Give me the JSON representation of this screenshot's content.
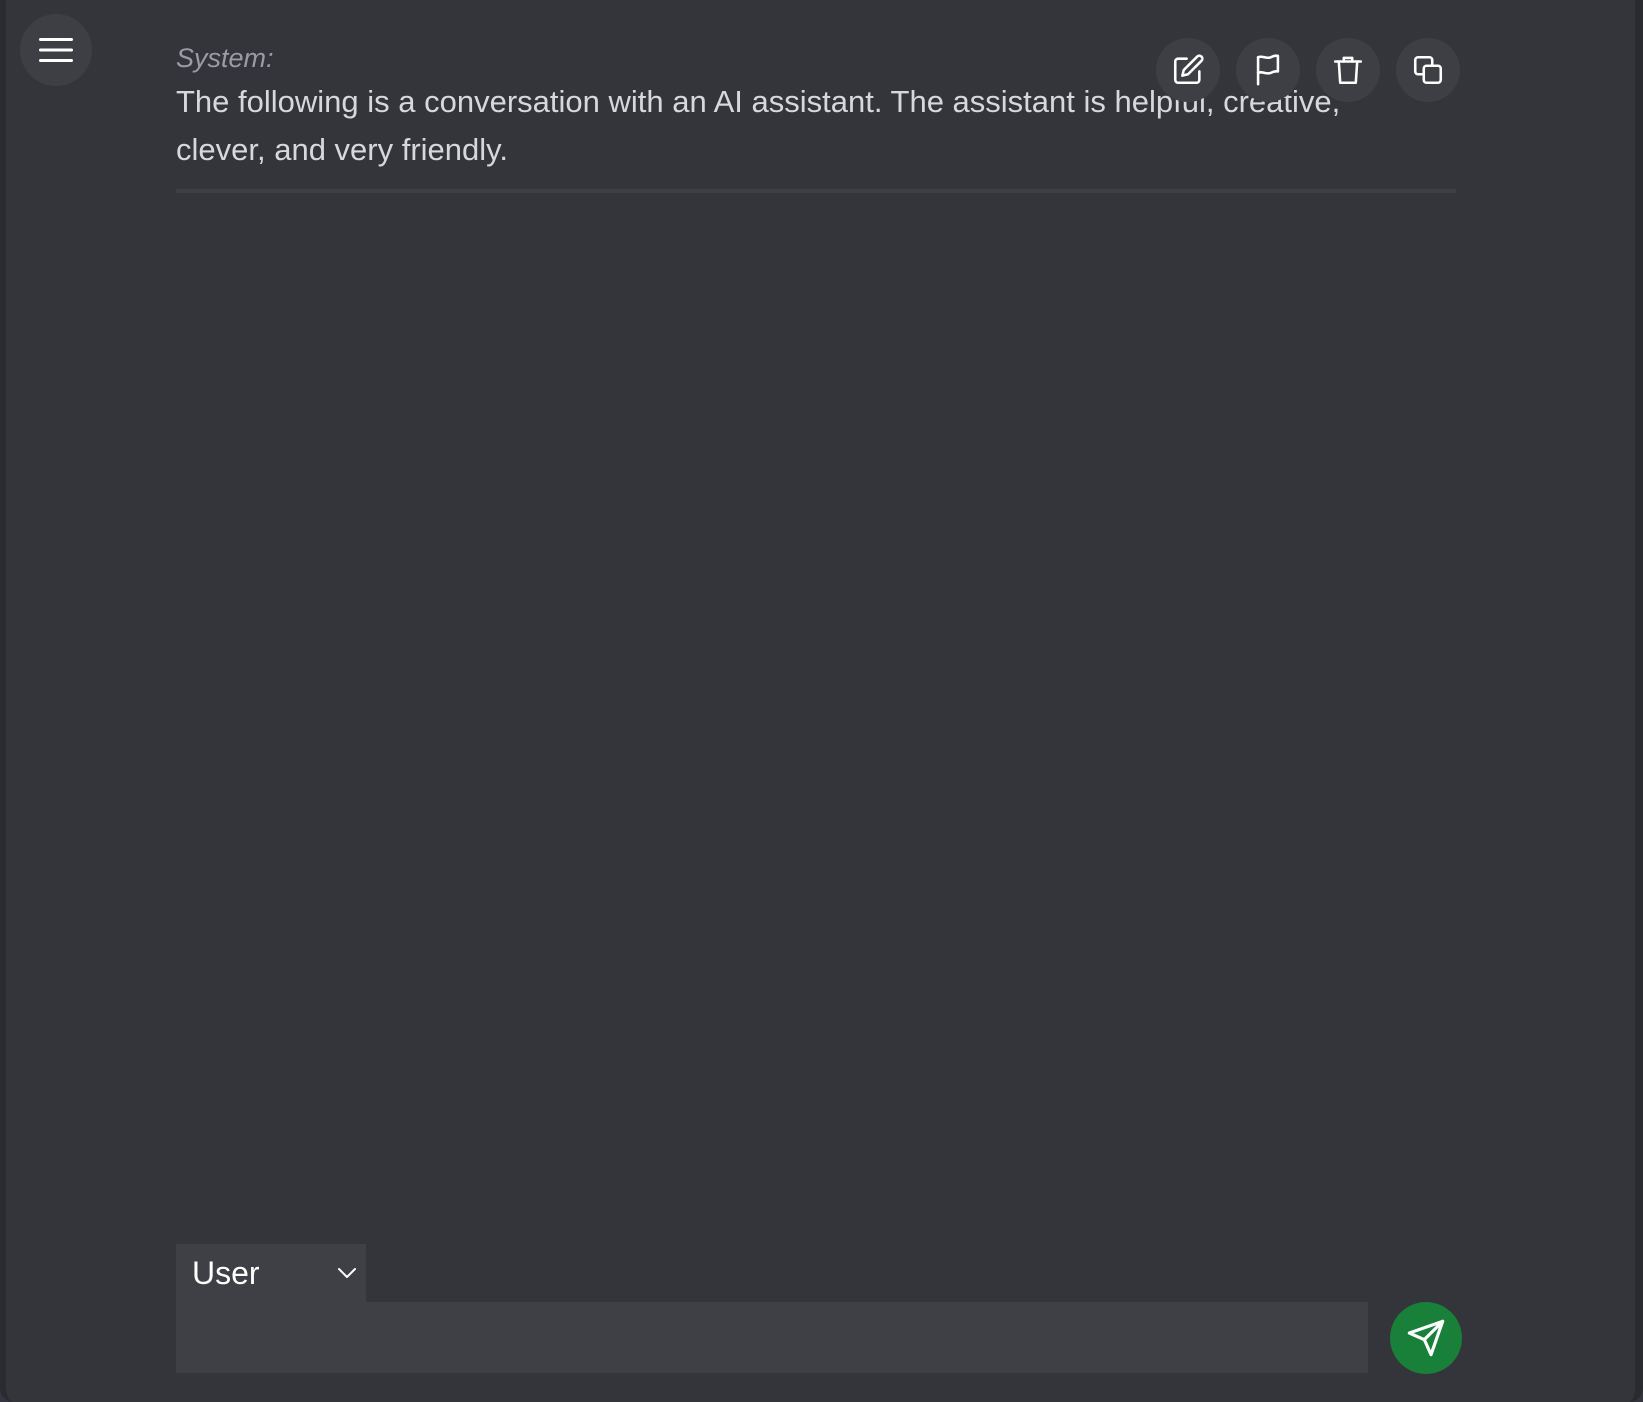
{
  "menu": {
    "icon": "hamburger-menu-icon"
  },
  "message": {
    "role_label": "System:",
    "text": "The following is a conversation with an AI assistant. The assistant is helpful, creative, clever, and very friendly."
  },
  "actions": [
    {
      "name": "edit",
      "icon": "edit-icon"
    },
    {
      "name": "flag",
      "icon": "flag-icon"
    },
    {
      "name": "delete",
      "icon": "trash-icon"
    },
    {
      "name": "copy",
      "icon": "copy-icon"
    }
  ],
  "composer": {
    "role_selected": "User",
    "input_value": "",
    "input_placeholder": "",
    "send_icon": "send-icon"
  },
  "colors": {
    "background": "#34353a",
    "button_bg": "#3e3f45",
    "send_bg": "#188038"
  }
}
